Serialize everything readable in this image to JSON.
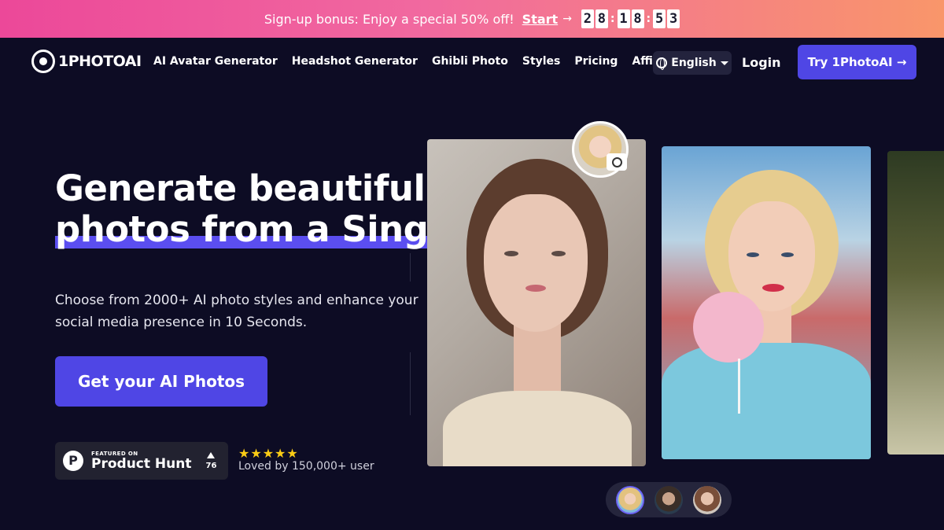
{
  "promo": {
    "text": "Sign-up bonus: Enjoy a special 50% off!",
    "start_label": "Start",
    "arrow": "→",
    "timer_digits": [
      "2",
      "8",
      "1",
      "8",
      "5",
      "3"
    ],
    "separator": ":"
  },
  "brand": {
    "name": "1PHOTOAI",
    "badge": "one"
  },
  "nav": {
    "links": [
      "AI Avatar Generator",
      "Headshot Generator",
      "Ghibli Photo",
      "Styles",
      "Pricing",
      "Affiliates"
    ],
    "language": "English",
    "login": "Login",
    "try_button": "Try 1PhotoAI →"
  },
  "hero": {
    "title_line1": "Generate beautiful AI",
    "title_line2": "photos from a Single Selfie",
    "subtitle": "Choose from 2000+ AI photo styles and enhance your social media presence in 10 Seconds.",
    "cta": "Get your AI Photos"
  },
  "product_hunt": {
    "featured": "FEATURED ON",
    "name": "Product Hunt",
    "logo_letter": "P",
    "votes": "76"
  },
  "rating": {
    "stars": "★★★★★",
    "text": "Loved by 150,000+ user"
  },
  "colors": {
    "accent": "#4f46e5",
    "background": "#0d0c24",
    "promo_start": "#ec4899",
    "promo_end": "#f9966a",
    "stars": "#facc15"
  }
}
